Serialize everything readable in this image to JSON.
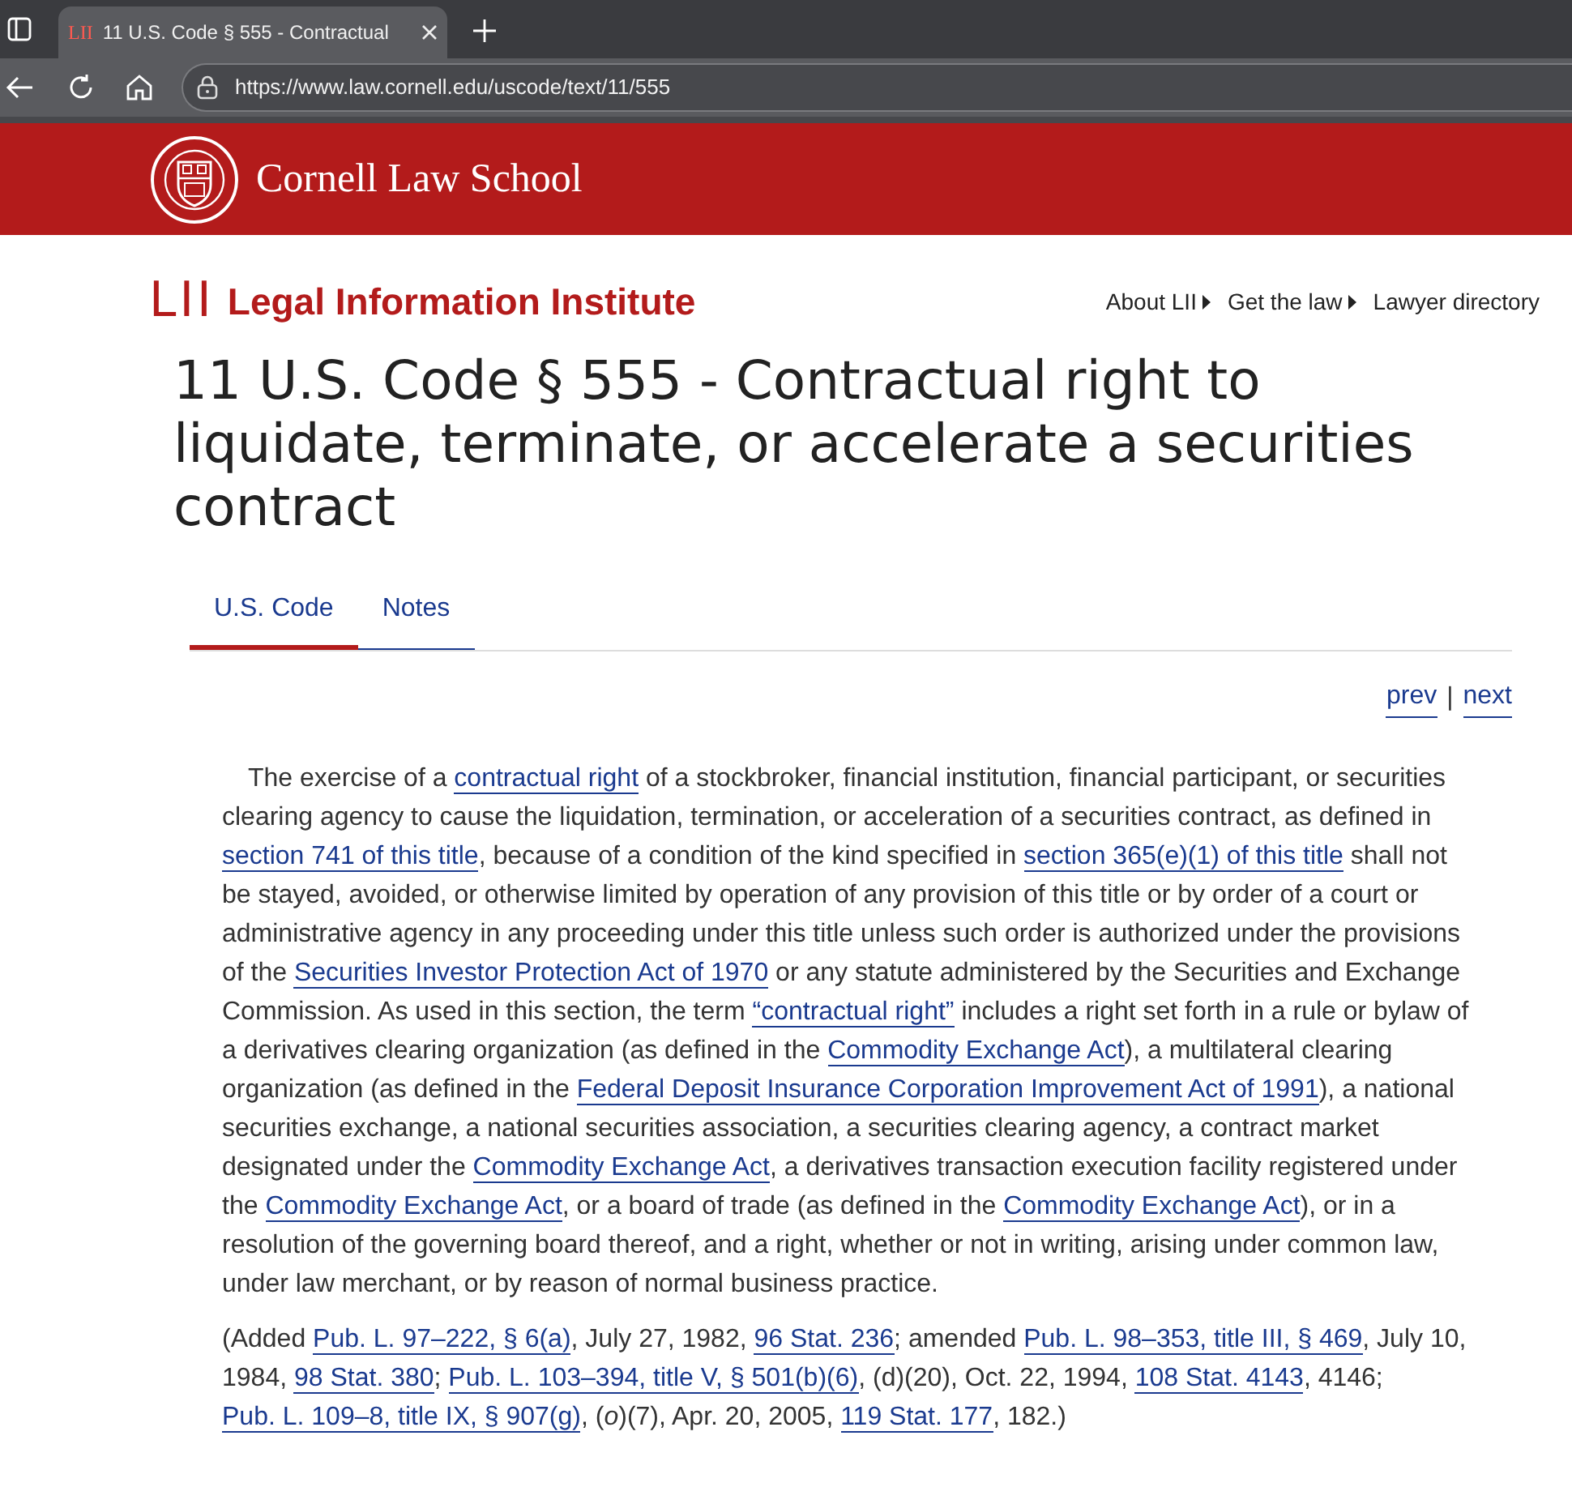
{
  "browser": {
    "tab": {
      "favicon": "LII",
      "title": "11 U.S. Code § 555 - Contractual"
    },
    "url": "https://www.law.cornell.edu/uscode/text/11/555"
  },
  "banner": {
    "name": "Cornell Law School"
  },
  "header": {
    "logo": "LII",
    "name": "Legal Information Institute",
    "nav": [
      {
        "label": "About LII",
        "menu": true
      },
      {
        "label": "Get the law",
        "menu": true
      },
      {
        "label": "Lawyer directory",
        "menu": false
      }
    ]
  },
  "title": "11 U.S. Code § 555 - Contractual right to liquidate, terminate, or accelerate a securities contract",
  "tabs": [
    {
      "label": "U.S. Code",
      "selected": true
    },
    {
      "label": "Notes",
      "selected": false
    }
  ],
  "pager": {
    "prev": "prev",
    "separator": "|",
    "next": "next"
  },
  "body": [
    {
      "kind": "text",
      "text": "The exercise of a "
    },
    {
      "kind": "link",
      "text": "contractual right"
    },
    {
      "kind": "text",
      "text": " of a stockbroker, financial institution, financial participant, or securities clearing agency to cause the liquidation, termination, or acceleration of a securities contract, as defined in "
    },
    {
      "kind": "link",
      "text": "section 741 of this title"
    },
    {
      "kind": "text",
      "text": ", because of a condition of the kind specified in "
    },
    {
      "kind": "link",
      "text": "section 365(e)(1) of this title"
    },
    {
      "kind": "text",
      "text": " shall not be stayed, avoided, or otherwise limited by operation of any provision of this title or by order of a court or administrative agency in any proceeding under this title unless such order is authorized under the provisions of the "
    },
    {
      "kind": "link",
      "text": "Securities Investor Protection Act of 1970"
    },
    {
      "kind": "text",
      "text": " or any statute administered by the Securities and Exchange Commission. As used in this section, the term "
    },
    {
      "kind": "link",
      "text": "“contractual right”"
    },
    {
      "kind": "text",
      "text": " includes a right set forth in a rule or bylaw of a derivatives clearing organization (as defined in the "
    },
    {
      "kind": "link",
      "text": "Commodity Exchange Act"
    },
    {
      "kind": "text",
      "text": "), a multilateral clearing organization (as defined in the "
    },
    {
      "kind": "link",
      "text": "Federal Deposit Insurance Corporation Improvement Act of 1991"
    },
    {
      "kind": "text",
      "text": "), a national securities exchange, a national securities association, a securities clearing agency, a contract market designated under the "
    },
    {
      "kind": "link",
      "text": "Commodity Exchange Act"
    },
    {
      "kind": "text",
      "text": ", a derivatives transaction execution facility registered under the "
    },
    {
      "kind": "link",
      "text": "Commodity Exchange Act"
    },
    {
      "kind": "text",
      "text": ", or a board of trade (as defined in the "
    },
    {
      "kind": "link",
      "text": "Commodity Exchange Act"
    },
    {
      "kind": "text",
      "text": "), or in a resolution of the governing board thereof, and a right, whether or not in writing, arising under common law, under law merchant, or by reason of normal business practice."
    }
  ],
  "credits": [
    {
      "kind": "text",
      "text": "(Added "
    },
    {
      "kind": "link",
      "text": "Pub. L. 97–222, § 6(a)"
    },
    {
      "kind": "text",
      "text": ", July 27, 1982, "
    },
    {
      "kind": "link",
      "text": "96 Stat. 236"
    },
    {
      "kind": "text",
      "text": "; amended "
    },
    {
      "kind": "link",
      "text": "Pub. L. 98–353, title III, § 469"
    },
    {
      "kind": "text",
      "text": ", July 10, 1984, "
    },
    {
      "kind": "link",
      "text": "98 Stat. 380"
    },
    {
      "kind": "text",
      "text": "; "
    },
    {
      "kind": "link",
      "text": "Pub. L. 103–394, title V, § 501(b)(6)"
    },
    {
      "kind": "text",
      "text": ", (d)(20), Oct. 22, 1994, "
    },
    {
      "kind": "link",
      "text": "108 Stat. 4143"
    },
    {
      "kind": "text",
      "text": ", 4146; "
    },
    {
      "kind": "link",
      "text": "Pub. L. 109–8, title IX, § 907(g)"
    },
    {
      "kind": "text",
      "text": ", (*o*)(7), Apr. 20, 2005, "
    },
    {
      "kind": "link",
      "text": "119 Stat. 177"
    },
    {
      "kind": "text",
      "text": ", 182.)"
    }
  ]
}
